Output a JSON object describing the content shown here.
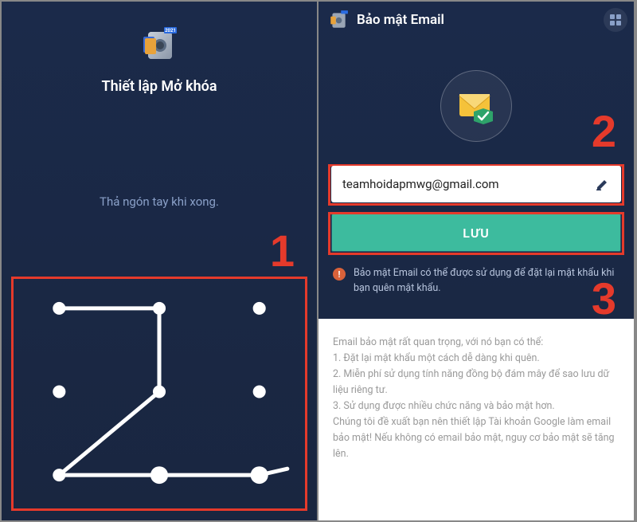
{
  "left": {
    "title": "Thiết lập Mở khóa",
    "hint": "Thả ngón tay khi xong.",
    "step": "1"
  },
  "right": {
    "header_title": "Bảo mật Email",
    "email_value": "teamhoidapmwg@gmail.com",
    "save_label": "LƯU",
    "warning": "Bảo mật Email có thể được sử dụng để đặt lại mật khẩu khi bạn quên mật khẩu.",
    "info_intro": "Email bảo mật rất quan trọng, với nó bạn có thể:",
    "info_1": "1. Đặt lại mật khẩu một cách dễ dàng khi quên.",
    "info_2": "2. Miễn phí sử dụng tính năng đồng bộ đám mây để sao lưu dữ liệu riêng tư.",
    "info_3": "3. Sử dụng được nhiều chức năng và bảo mật hơn.",
    "info_outro": "Chúng tôi đề xuất bạn nên thiết lập Tài khoản Google làm email bảo mật! Nếu không có email bảo mật, nguy cơ bảo mật sẽ tăng lên.",
    "step2": "2",
    "step3": "3"
  },
  "colors": {
    "accent_red": "#e53a2b",
    "teal": "#3dbb9e",
    "bg_dark": "#1a2845"
  }
}
